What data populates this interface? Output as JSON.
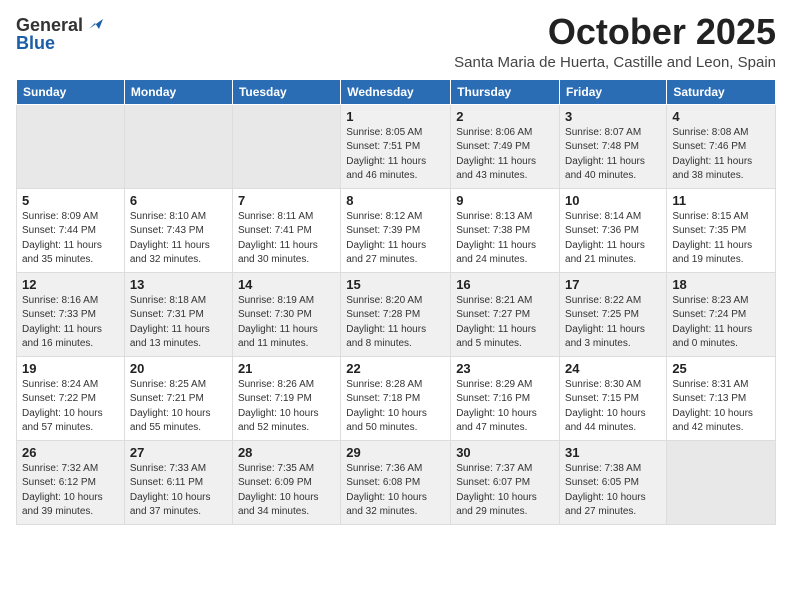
{
  "logo": {
    "general": "General",
    "blue": "Blue"
  },
  "header": {
    "month": "October 2025",
    "location": "Santa Maria de Huerta, Castille and Leon, Spain"
  },
  "weekdays": [
    "Sunday",
    "Monday",
    "Tuesday",
    "Wednesday",
    "Thursday",
    "Friday",
    "Saturday"
  ],
  "weeks": [
    [
      {
        "day": "",
        "info": ""
      },
      {
        "day": "",
        "info": ""
      },
      {
        "day": "",
        "info": ""
      },
      {
        "day": "1",
        "info": "Sunrise: 8:05 AM\nSunset: 7:51 PM\nDaylight: 11 hours\nand 46 minutes."
      },
      {
        "day": "2",
        "info": "Sunrise: 8:06 AM\nSunset: 7:49 PM\nDaylight: 11 hours\nand 43 minutes."
      },
      {
        "day": "3",
        "info": "Sunrise: 8:07 AM\nSunset: 7:48 PM\nDaylight: 11 hours\nand 40 minutes."
      },
      {
        "day": "4",
        "info": "Sunrise: 8:08 AM\nSunset: 7:46 PM\nDaylight: 11 hours\nand 38 minutes."
      }
    ],
    [
      {
        "day": "5",
        "info": "Sunrise: 8:09 AM\nSunset: 7:44 PM\nDaylight: 11 hours\nand 35 minutes."
      },
      {
        "day": "6",
        "info": "Sunrise: 8:10 AM\nSunset: 7:43 PM\nDaylight: 11 hours\nand 32 minutes."
      },
      {
        "day": "7",
        "info": "Sunrise: 8:11 AM\nSunset: 7:41 PM\nDaylight: 11 hours\nand 30 minutes."
      },
      {
        "day": "8",
        "info": "Sunrise: 8:12 AM\nSunset: 7:39 PM\nDaylight: 11 hours\nand 27 minutes."
      },
      {
        "day": "9",
        "info": "Sunrise: 8:13 AM\nSunset: 7:38 PM\nDaylight: 11 hours\nand 24 minutes."
      },
      {
        "day": "10",
        "info": "Sunrise: 8:14 AM\nSunset: 7:36 PM\nDaylight: 11 hours\nand 21 minutes."
      },
      {
        "day": "11",
        "info": "Sunrise: 8:15 AM\nSunset: 7:35 PM\nDaylight: 11 hours\nand 19 minutes."
      }
    ],
    [
      {
        "day": "12",
        "info": "Sunrise: 8:16 AM\nSunset: 7:33 PM\nDaylight: 11 hours\nand 16 minutes."
      },
      {
        "day": "13",
        "info": "Sunrise: 8:18 AM\nSunset: 7:31 PM\nDaylight: 11 hours\nand 13 minutes."
      },
      {
        "day": "14",
        "info": "Sunrise: 8:19 AM\nSunset: 7:30 PM\nDaylight: 11 hours\nand 11 minutes."
      },
      {
        "day": "15",
        "info": "Sunrise: 8:20 AM\nSunset: 7:28 PM\nDaylight: 11 hours\nand 8 minutes."
      },
      {
        "day": "16",
        "info": "Sunrise: 8:21 AM\nSunset: 7:27 PM\nDaylight: 11 hours\nand 5 minutes."
      },
      {
        "day": "17",
        "info": "Sunrise: 8:22 AM\nSunset: 7:25 PM\nDaylight: 11 hours\nand 3 minutes."
      },
      {
        "day": "18",
        "info": "Sunrise: 8:23 AM\nSunset: 7:24 PM\nDaylight: 11 hours\nand 0 minutes."
      }
    ],
    [
      {
        "day": "19",
        "info": "Sunrise: 8:24 AM\nSunset: 7:22 PM\nDaylight: 10 hours\nand 57 minutes."
      },
      {
        "day": "20",
        "info": "Sunrise: 8:25 AM\nSunset: 7:21 PM\nDaylight: 10 hours\nand 55 minutes."
      },
      {
        "day": "21",
        "info": "Sunrise: 8:26 AM\nSunset: 7:19 PM\nDaylight: 10 hours\nand 52 minutes."
      },
      {
        "day": "22",
        "info": "Sunrise: 8:28 AM\nSunset: 7:18 PM\nDaylight: 10 hours\nand 50 minutes."
      },
      {
        "day": "23",
        "info": "Sunrise: 8:29 AM\nSunset: 7:16 PM\nDaylight: 10 hours\nand 47 minutes."
      },
      {
        "day": "24",
        "info": "Sunrise: 8:30 AM\nSunset: 7:15 PM\nDaylight: 10 hours\nand 44 minutes."
      },
      {
        "day": "25",
        "info": "Sunrise: 8:31 AM\nSunset: 7:13 PM\nDaylight: 10 hours\nand 42 minutes."
      }
    ],
    [
      {
        "day": "26",
        "info": "Sunrise: 7:32 AM\nSunset: 6:12 PM\nDaylight: 10 hours\nand 39 minutes."
      },
      {
        "day": "27",
        "info": "Sunrise: 7:33 AM\nSunset: 6:11 PM\nDaylight: 10 hours\nand 37 minutes."
      },
      {
        "day": "28",
        "info": "Sunrise: 7:35 AM\nSunset: 6:09 PM\nDaylight: 10 hours\nand 34 minutes."
      },
      {
        "day": "29",
        "info": "Sunrise: 7:36 AM\nSunset: 6:08 PM\nDaylight: 10 hours\nand 32 minutes."
      },
      {
        "day": "30",
        "info": "Sunrise: 7:37 AM\nSunset: 6:07 PM\nDaylight: 10 hours\nand 29 minutes."
      },
      {
        "day": "31",
        "info": "Sunrise: 7:38 AM\nSunset: 6:05 PM\nDaylight: 10 hours\nand 27 minutes."
      },
      {
        "day": "",
        "info": ""
      }
    ]
  ]
}
